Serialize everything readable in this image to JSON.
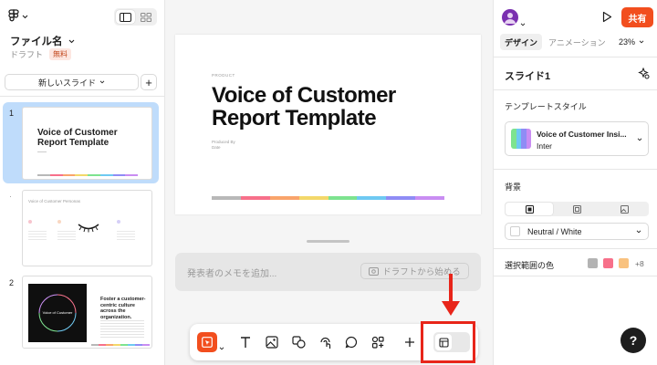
{
  "left": {
    "file_name": "ファイル名",
    "draft": "ドラフト",
    "free_badge": "無料",
    "new_slide": "新しいスライド"
  },
  "slides": [
    {
      "number": "1",
      "title": "Voice of Customer Report Template"
    },
    {
      "number": "",
      "title": "Voice of Customer Personas"
    },
    {
      "number": "2",
      "heading": "Foster a customer-centric culture across the organization.",
      "center_label": "Voice of Customer"
    }
  ],
  "canvas": {
    "label": "PRODUCT",
    "title_line1": "Voice of Customer",
    "title_line2": "Report Template",
    "produced_by": "Produced By",
    "date": "Date"
  },
  "notes": {
    "placeholder": "発表者のメモを追加...",
    "draft_button": "ドラフトから始める"
  },
  "right": {
    "share": "共有",
    "tab_design": "デザイン",
    "tab_animation": "アニメーション",
    "zoom": "23%",
    "slide_title": "スライド1",
    "template_style": "テンプレートスタイル",
    "template_name": "Voice of Customer Insi...",
    "template_font": "Inter",
    "background": "背景",
    "background_value": "Neutral / White",
    "selection_colors": "選択範囲の色",
    "selection_more": "+8",
    "help": "?"
  },
  "colors": {
    "accent": "#f24e1e",
    "selection_blue": "#bfdcfb",
    "highlight_red": "#e8251a",
    "rainbow": [
      "#b8b8b8",
      "#f7708a",
      "#f9a46b",
      "#f3d86a",
      "#7de38f",
      "#6ec9f2",
      "#8f8cf5",
      "#c98df2"
    ],
    "swatches": [
      "#b3b3b3",
      "#f7708a",
      "#f9c27f"
    ]
  }
}
